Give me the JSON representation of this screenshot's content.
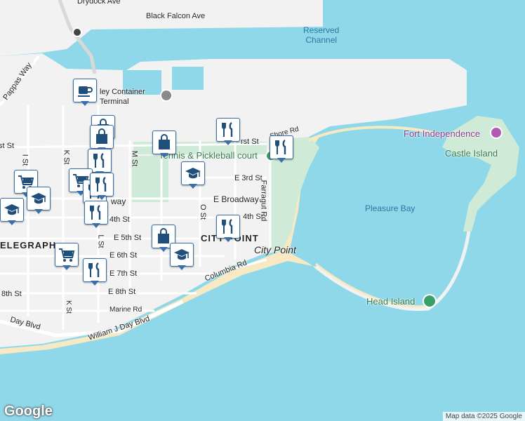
{
  "map": {
    "colors": {
      "water": "#8fd8ea",
      "land": "#f2f2f2",
      "park": "#cfead6",
      "beach": "#f6e9c4",
      "road": "#ffffff",
      "pin_fill": "#1f4f7a",
      "pin_border": "#3a6fa8",
      "park_marker": "#3aa06a",
      "museum_marker": "#b05ab0"
    },
    "labels": {
      "drydock": "Drydock Ave",
      "black_falcon": "Black Falcon Ave",
      "reserved_channel": "Reserved\nChannel",
      "pappas": "Pappas Way",
      "container_terminal": "ley Container\nTerminal",
      "first_st": "rst St",
      "first_st_left": "st St",
      "shore_rd": "Shore Rd",
      "m_st": "M St",
      "k_st": "K St",
      "i_st": "I St",
      "tennis": "Tennis & Pickleball court",
      "e_3rd": "E 3rd St",
      "e_broadway": "E Broadway",
      "way_frag": "way",
      "o_st": "O St",
      "fourth_st": "4th St",
      "fourth_st_left": "4th St",
      "farragut": "Farragut Rd",
      "telegraph": "ELEGRAPH",
      "l_st": "L St",
      "e_5th": "E 5th St",
      "e_6th": "E 6th St",
      "e_7th": "E 7th St",
      "city_point_hood": "CITY POINT",
      "city_point_place": "City Point",
      "columbia": "Columbia Rd",
      "e_8th": "E 8th St",
      "eighth_left": "8th St",
      "marine": "Marine Rd",
      "k_st_south": "K St",
      "day_blvd_left": "Day Blvd",
      "william_j_day": "William J Day Blvd",
      "fort_independence": "Fort Independence",
      "castle_island": "Castle Island",
      "pleasure_bay": "Pleasure Bay",
      "head_island": "Head Island"
    },
    "attribution": "Map data ©2025 Google",
    "google_logo": "Google",
    "pois": [
      {
        "icon": "coffee-icon"
      },
      {
        "icon": "shopping-bag-icon"
      },
      {
        "icon": "shopping-bag-icon"
      },
      {
        "icon": "restaurant-icon"
      },
      {
        "icon": "shopping-bag-icon"
      },
      {
        "icon": "restaurant-icon"
      },
      {
        "icon": "restaurant-icon"
      },
      {
        "icon": "school-icon"
      },
      {
        "icon": "shopping-cart-icon"
      },
      {
        "icon": "shopping-cart-icon"
      },
      {
        "icon": "school-icon"
      },
      {
        "icon": "school-icon"
      },
      {
        "icon": "restaurant-icon"
      },
      {
        "icon": "restaurant-icon"
      },
      {
        "icon": "restaurant-icon"
      },
      {
        "icon": "shopping-bag-icon"
      },
      {
        "icon": "school-icon"
      },
      {
        "icon": "shopping-cart-icon"
      },
      {
        "icon": "restaurant-icon"
      },
      {
        "icon": "restaurant-icon"
      }
    ]
  }
}
